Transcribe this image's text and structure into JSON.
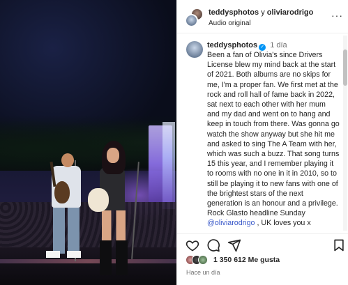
{
  "post": {
    "header": {
      "author1": "teddysphotos",
      "conjunction": "y",
      "author2": "oliviarodrigo",
      "audio": "Audio original",
      "more": "···"
    },
    "caption": {
      "username": "teddysphotos",
      "verified_mark": "✓",
      "time": "1 día",
      "text_part1": "Been a fan of Olivia's since Drivers License blew my mind back at the start of 2021. Both albums are no skips for me, I'm a proper fan. We first met at the rock and roll hall of fame back in 2022, sat next to each other with her mum and my dad and went on to hang and keep in touch from there. Was gonna go watch the show anyway but she hit me and asked to sing The A Team with her, which was such a buzz. That song turns 15 this year, and I remember playing it to rooms with no one in it in 2010, so to still be playing it to new fans with one of the brightest stars of the next generation is an honour and a privilege. Rock Glasto headline Sunday ",
      "mention": "@oliviarodrigo",
      "text_part2": " , UK loves you x"
    },
    "likes": {
      "count": "1 350 612",
      "label": "Me gusta"
    },
    "posted_ago": "Hace un día"
  }
}
